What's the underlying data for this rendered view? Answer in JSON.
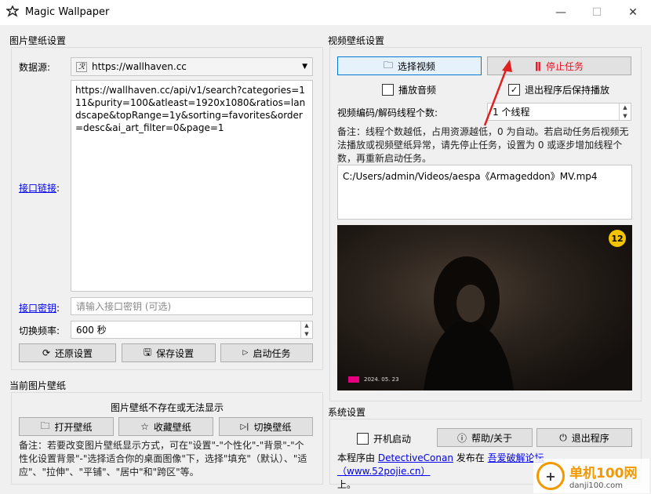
{
  "window": {
    "title": "Magic Wallpaper",
    "minimize": "—",
    "maximize": "☐",
    "close": "✕"
  },
  "image_settings": {
    "group_title": "图片壁纸设置",
    "source_label": "数据源:",
    "source_value": "https://wallhaven.cc",
    "api_link_label": "接口链接",
    "api_link_colon": ":",
    "api_url": "https://wallhaven.cc/api/v1/search?categories=111&purity=100&atleast=1920x1080&ratios=landscape&topRange=1y&sorting=favorites&order=desc&ai_art_filter=0&page=1",
    "api_key_label": "接口密钥",
    "api_key_colon": ":",
    "api_key_placeholder": "请输入接口密钥 (可选)",
    "interval_label": "切换频率:",
    "interval_value": "600 秒",
    "restore_button": "还原设置",
    "save_button": "保存设置",
    "start_button": "启动任务"
  },
  "current_wallpaper": {
    "group_title": "当前图片壁纸",
    "status_text": "图片壁纸不存在或无法显示",
    "open_button": "打开壁纸",
    "favorite_button": "收藏壁纸",
    "switch_button": "切换壁纸",
    "note": "备注：若要改变图片壁纸显示方式，可在\"设置\"-\"个性化\"-\"背景\"-\"个性化设置背景\"-\"选择适合你的桌面图像\"下，选择\"填充\"（默认）、\"适应\"、\"拉伸\"、\"平铺\"、\"居中\"和\"跨区\"等。"
  },
  "video_settings": {
    "group_title": "视频壁纸设置",
    "select_video_button": "选择视频",
    "stop_task_button": "停止任务",
    "play_audio_label": "播放音频",
    "play_audio_checked": false,
    "keep_playing_label": "退出程序后保持播放",
    "keep_playing_checked": true,
    "threads_label": "视频编码/解码线程个数:",
    "threads_value": "1 个线程",
    "note": "备注：线程个数越低，占用资源越低，0 为自动。若启动任务后视频无法播放或视频壁纸异常，请先停止任务，设置为 0 或逐步增加线程个数，再重新启动任务。",
    "video_path": "C:/Users/admin/Videos/aespa《Armageddon》MV.mp4",
    "preview": {
      "rating_badge": "12",
      "watermark": "2024. 05. 23"
    }
  },
  "system_settings": {
    "group_title": "系统设置",
    "autostart_label": "开机启动",
    "autostart_checked": false,
    "help_button": "帮助/关于",
    "exit_button": "退出程序",
    "footer_prefix": "本程序由 ",
    "author_link": "DetectiveConan",
    "footer_mid": " 发布在 ",
    "forum_link": "吾爱破解论坛（www.52pojie.cn）",
    "footer_suffix": "上。"
  },
  "site_watermark": {
    "name": "单机100网",
    "domain": "danji100.com"
  },
  "colors": {
    "stop_red": "#e81123",
    "link_blue": "#0000ee",
    "accent_blue": "#0078d7"
  }
}
